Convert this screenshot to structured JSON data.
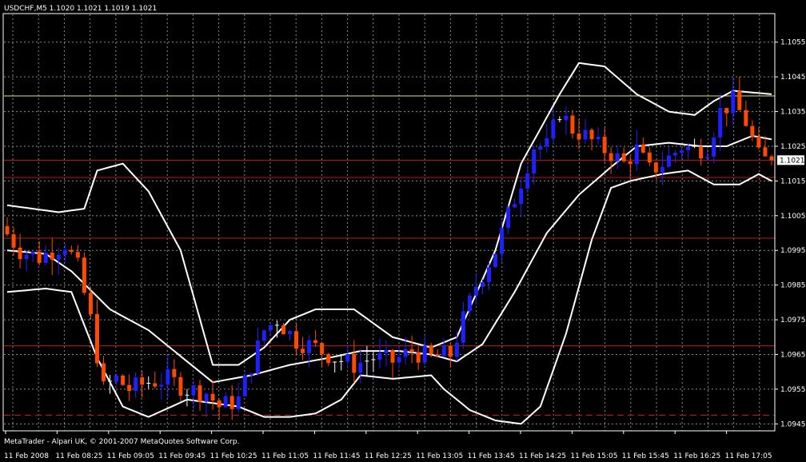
{
  "header": {
    "title": "USDCHF,M5  1.1020 1.1021 1.1019 1.1021"
  },
  "footer": {
    "copyright": "MetaTrader - Alpari UK, © 2001-2007 MetaQuotes Software Corp."
  },
  "current_price_label": "1.1021",
  "colors": {
    "background": "#000000",
    "grid": "#8a8a8a",
    "bull": "#2020ff",
    "bear": "#ff4a00",
    "band": "#ffffff",
    "level_red": "#c01818",
    "level_yellow": "#e0e080",
    "price_tag_bg": "#ffffff"
  },
  "chart_data": {
    "type": "candlestick",
    "symbol": "USDCHF",
    "timeframe": "M5",
    "ylim": [
      1.0943,
      1.1063
    ],
    "y_ticks": [
      "1.1055",
      "1.1045",
      "1.1035",
      "1.1025",
      "1.1015",
      "1.1005",
      "1.0995",
      "1.0985",
      "1.0975",
      "1.0965",
      "1.0955",
      "1.0945"
    ],
    "x_ticks": [
      "11 Feb 2008",
      "11 Feb 08:25",
      "11 Feb 09:05",
      "11 Feb 09:45",
      "11 Feb 10:25",
      "11 Feb 11:05",
      "11 Feb 11:45",
      "11 Feb 12:25",
      "11 Feb 13:05",
      "11 Feb 13:45",
      "11 Feb 14:25",
      "11 Feb 15:05",
      "11 Feb 15:45",
      "11 Feb 16:25",
      "11 Feb 17:05"
    ],
    "bars": 120,
    "horizontal_levels": [
      {
        "value": 1.10395,
        "color": "#e0e080",
        "style": "solid"
      },
      {
        "value": 1.1021,
        "color": "#c01818",
        "style": "solid"
      },
      {
        "value": 1.1016,
        "color": "#c01818",
        "style": "solid"
      },
      {
        "value": 1.09985,
        "color": "#c01818",
        "style": "solid"
      },
      {
        "value": 1.09675,
        "color": "#c01818",
        "style": "solid"
      },
      {
        "value": 1.09475,
        "color": "#c01818",
        "style": "dashed"
      }
    ],
    "current_price": 1.1021,
    "bollinger": {
      "upper": [
        [
          0,
          1.1008
        ],
        [
          8,
          1.1006
        ],
        [
          12,
          1.1007
        ],
        [
          14,
          1.1018
        ],
        [
          18,
          1.102
        ],
        [
          22,
          1.1012
        ],
        [
          27,
          1.0995
        ],
        [
          32,
          1.0962
        ],
        [
          36,
          1.0962
        ],
        [
          40,
          1.0967
        ],
        [
          44,
          1.0975
        ],
        [
          48,
          1.0978
        ],
        [
          54,
          1.0978
        ],
        [
          60,
          1.097
        ],
        [
          66,
          1.0967
        ],
        [
          70,
          1.097
        ],
        [
          76,
          1.0995
        ],
        [
          80,
          1.102
        ],
        [
          86,
          1.104
        ],
        [
          89,
          1.1049
        ],
        [
          93,
          1.1048
        ],
        [
          98,
          1.104
        ],
        [
          103,
          1.1035
        ],
        [
          107,
          1.1034
        ],
        [
          110,
          1.1038
        ],
        [
          113,
          1.1041
        ],
        [
          119,
          1.104
        ]
      ],
      "middle": [
        [
          0,
          1.0995
        ],
        [
          6,
          1.0994
        ],
        [
          10,
          1.0989
        ],
        [
          16,
          1.0978
        ],
        [
          22,
          1.0972
        ],
        [
          28,
          1.0963
        ],
        [
          32,
          1.0957
        ],
        [
          38,
          1.0959
        ],
        [
          44,
          1.0962
        ],
        [
          50,
          1.0964
        ],
        [
          55,
          1.0966
        ],
        [
          61,
          1.0966
        ],
        [
          66,
          1.0965
        ],
        [
          70,
          1.0963
        ],
        [
          74,
          1.0968
        ],
        [
          79,
          1.0983
        ],
        [
          84,
          1.1
        ],
        [
          89,
          1.1011
        ],
        [
          94,
          1.1019
        ],
        [
          98,
          1.1025
        ],
        [
          103,
          1.1026
        ],
        [
          108,
          1.1025
        ],
        [
          112,
          1.1025
        ],
        [
          116,
          1.1028
        ],
        [
          119,
          1.1027
        ]
      ],
      "lower": [
        [
          0,
          1.0983
        ],
        [
          6,
          1.0984
        ],
        [
          10,
          1.0983
        ],
        [
          14,
          1.0964
        ],
        [
          18,
          1.095
        ],
        [
          22,
          1.0947
        ],
        [
          28,
          1.0952
        ],
        [
          32,
          1.0951
        ],
        [
          36,
          1.095
        ],
        [
          40,
          1.0947
        ],
        [
          44,
          1.0947
        ],
        [
          48,
          1.0948
        ],
        [
          52,
          1.0952
        ],
        [
          55,
          1.0959
        ],
        [
          60,
          1.0958
        ],
        [
          66,
          1.0959
        ],
        [
          68,
          1.0955
        ],
        [
          72,
          1.0949
        ],
        [
          76,
          1.0946
        ],
        [
          80,
          1.0945
        ],
        [
          83,
          1.095
        ],
        [
          87,
          1.0971
        ],
        [
          91,
          1.0998
        ],
        [
          94,
          1.1013
        ],
        [
          97,
          1.1015
        ],
        [
          102,
          1.1017
        ],
        [
          106,
          1.1018
        ],
        [
          110,
          1.1014
        ],
        [
          114,
          1.1014
        ],
        [
          117,
          1.1017
        ],
        [
          119,
          1.1015
        ]
      ]
    },
    "anchors": [
      [
        0,
        1.1002
      ],
      [
        3,
        1.0995
      ],
      [
        6,
        1.0993
      ],
      [
        10,
        1.0997
      ],
      [
        12,
        1.099
      ],
      [
        14,
        1.0975
      ],
      [
        16,
        1.0955
      ],
      [
        18,
        1.0958
      ],
      [
        20,
        1.0955
      ],
      [
        23,
        1.0957
      ],
      [
        26,
        1.0958
      ],
      [
        29,
        1.0955
      ],
      [
        32,
        1.0954
      ],
      [
        34,
        1.095
      ],
      [
        37,
        1.0952
      ],
      [
        39,
        1.0962
      ],
      [
        41,
        1.0972
      ],
      [
        43,
        1.0975
      ],
      [
        46,
        1.0969
      ],
      [
        49,
        1.0967
      ],
      [
        52,
        1.0964
      ],
      [
        55,
        1.0962
      ],
      [
        58,
        1.0964
      ],
      [
        61,
        1.0963
      ],
      [
        64,
        1.0966
      ],
      [
        67,
        1.0964
      ],
      [
        70,
        1.0965
      ],
      [
        72,
        1.0975
      ],
      [
        74,
        1.0985
      ],
      [
        77,
        1.0995
      ],
      [
        79,
        1.1005
      ],
      [
        81,
        1.1015
      ],
      [
        83,
        1.1025
      ],
      [
        85,
        1.1025
      ],
      [
        87,
        1.1035
      ],
      [
        89,
        1.103
      ],
      [
        91,
        1.1028
      ],
      [
        93,
        1.1025
      ],
      [
        95,
        1.1023
      ],
      [
        97,
        1.102
      ],
      [
        99,
        1.1024
      ],
      [
        101,
        1.1018
      ],
      [
        103,
        1.102
      ],
      [
        106,
        1.1025
      ],
      [
        108,
        1.1024
      ],
      [
        110,
        1.1025
      ],
      [
        112,
        1.1035
      ],
      [
        114,
        1.1038
      ],
      [
        116,
        1.1032
      ],
      [
        118,
        1.1022
      ],
      [
        119,
        1.1021
      ]
    ]
  }
}
